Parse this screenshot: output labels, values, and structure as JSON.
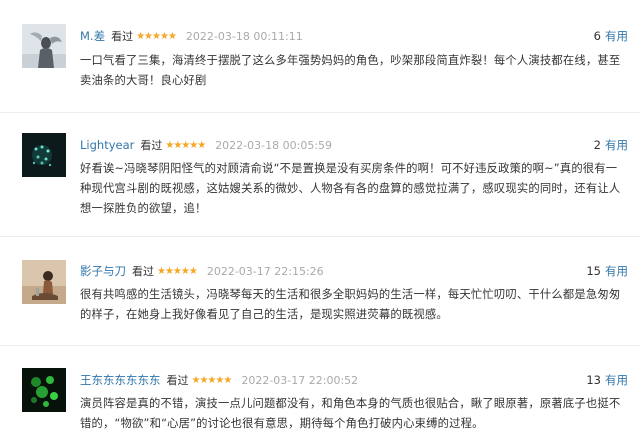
{
  "reviews": [
    {
      "username": "M.差",
      "action": "看过",
      "stars": "★★★★★",
      "time": "2022-03-18 00:11:11",
      "useful_count": "6",
      "useful_label": "有用",
      "content": "一口气看了三集，海清终于摆脱了这么多年强势妈妈的角色，吵架那段简直炸裂！每个人演技都在线，甚至卖油条的大哥！良心好剧"
    },
    {
      "username": "Lightyear",
      "action": "看过",
      "stars": "★★★★★",
      "time": "2022-03-18 00:05:59",
      "useful_count": "2",
      "useful_label": "有用",
      "content": "好看诶~冯晓琴阴阳怪气的对顾清俞说“不是置换是没有买房条件的啊！可不好违反政策的啊~”真的很有一种现代宫斗剧的既视感，这姑嫂关系的微妙、人物各有各的盘算的感觉拉满了，感叹现实的同时，还有让人想一探胜负的欲望，追！"
    },
    {
      "username": "影子与刀",
      "action": "看过",
      "stars": "★★★★★",
      "time": "2022-03-17 22:15:26",
      "useful_count": "15",
      "useful_label": "有用",
      "content": "很有共鸣感的生活镜头，冯晓琴每天的生活和很多全职妈妈的生活一样，每天忙忙叨叨、干什么都是急匆匆的样子，在她身上我好像看见了自己的生活，是现实照进荧幕的既视感。"
    },
    {
      "username": "王东东东东东东",
      "action": "看过",
      "stars": "★★★★★",
      "time": "2022-03-17 22:00:52",
      "useful_count": "13",
      "useful_label": "有用",
      "content": "演员阵容是真的不错，演技一点儿问题都没有，和角色本身的气质也很贴合，瞅了眼原著，原著底子也挺不错的，“物欲”和“心居”的讨论也很有意思，期待每个角色打破内心束缚的过程。"
    }
  ]
}
